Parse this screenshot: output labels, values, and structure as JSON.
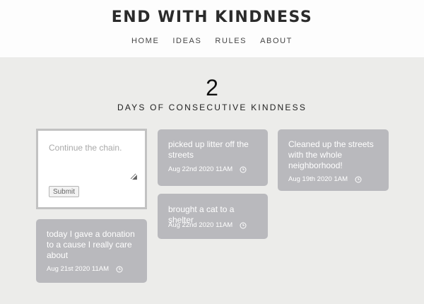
{
  "header": {
    "title": "END WITH KINDNESS",
    "nav": [
      "HOME",
      "IDEAS",
      "RULES",
      "ABOUT"
    ]
  },
  "counter": {
    "value": "2",
    "label": "DAYS OF CONSECUTIVE KINDNESS"
  },
  "form": {
    "placeholder": "Continue the chain.",
    "submit_label": "Submit"
  },
  "posts": [
    {
      "text": "picked up litter off the streets",
      "date": "Aug 22nd 2020 11AM",
      "icon": "clock-icon"
    },
    {
      "text": "Cleaned up the streets with the whole neighborhood!",
      "date": "Aug 19th 2020 1AM",
      "icon": "clock-icon"
    },
    {
      "text": "brought a cat to a shelter",
      "date": "Aug 22nd 2020 11AM",
      "icon": "clock-icon"
    },
    {
      "text": "today I gave a donation to a cause I really care about",
      "date": "Aug 21st 2020 11AM",
      "icon": "clock-icon"
    }
  ],
  "colors": {
    "card": "#b9b9bd",
    "background": "#ececea",
    "header": "#fdfdfd"
  }
}
